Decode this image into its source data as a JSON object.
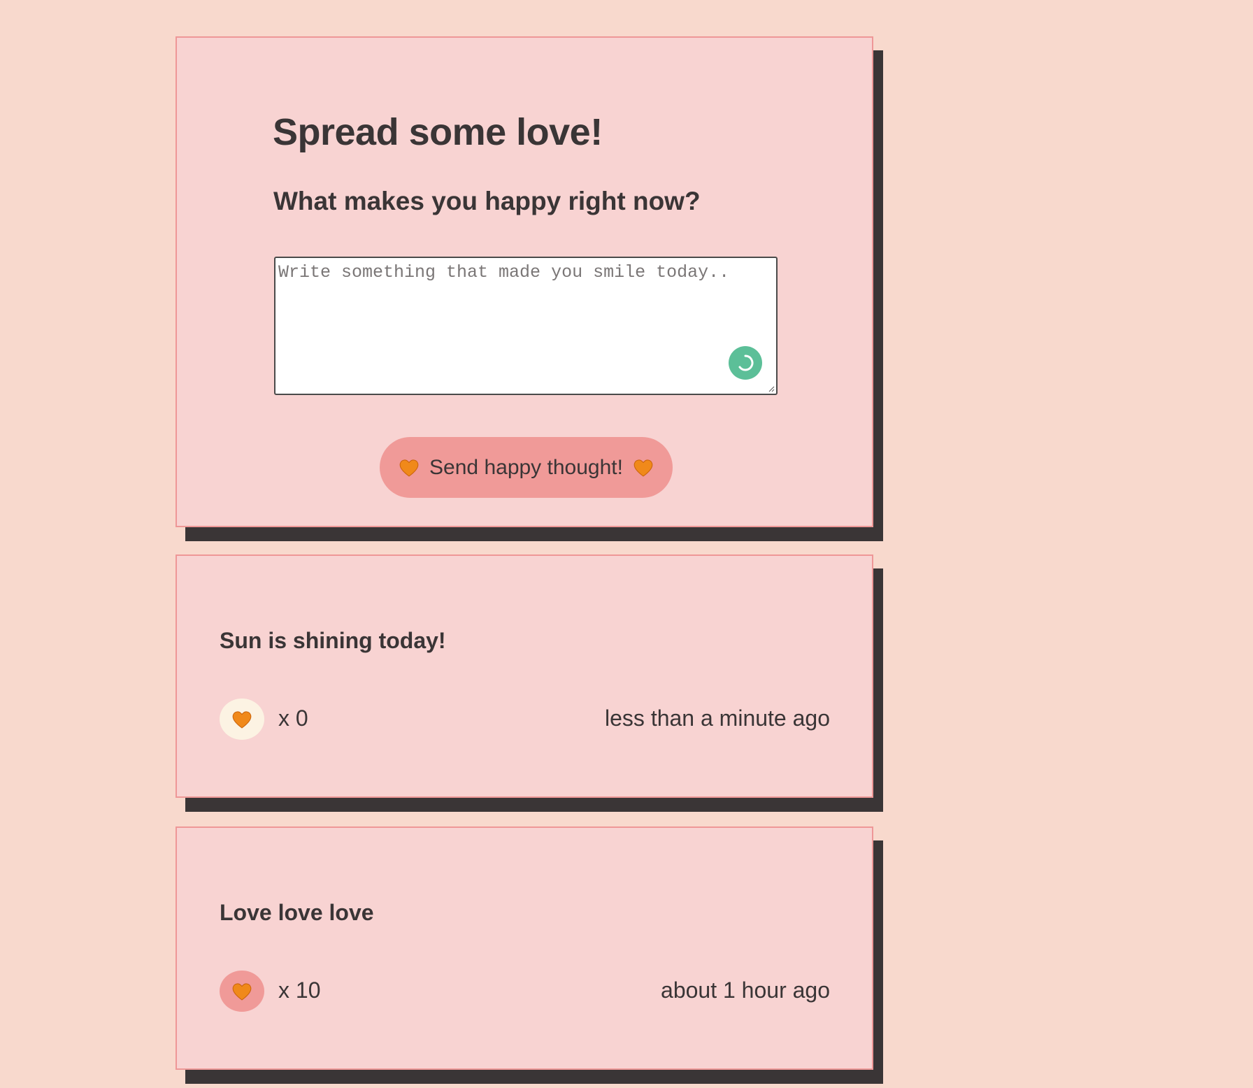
{
  "form": {
    "title": "Spread some love!",
    "question": "What makes you happy right now?",
    "placeholder": "Write something that made you smile today..",
    "value": "",
    "send_label": "Send happy thought!",
    "grammar_badge_color": "#5cbf98"
  },
  "thoughts": [
    {
      "message": "Sun is shining today!",
      "likes": "x 0",
      "liked": false,
      "time": "less than a minute ago"
    },
    {
      "message": "Love love love",
      "likes": "x 10",
      "liked": true,
      "time": "about 1 hour ago"
    }
  ],
  "colors": {
    "background": "#f8d9cd",
    "card": "#f8d3d2",
    "card_border": "#ee9797",
    "shadow": "#3a3536",
    "button": "#f09a98",
    "heart": "#f0891a",
    "like_inactive": "#fcf3e3",
    "like_active": "#f09a98"
  },
  "icons": {
    "heart": "orange-heart-icon",
    "grammar": "grammar-assistant-icon"
  }
}
